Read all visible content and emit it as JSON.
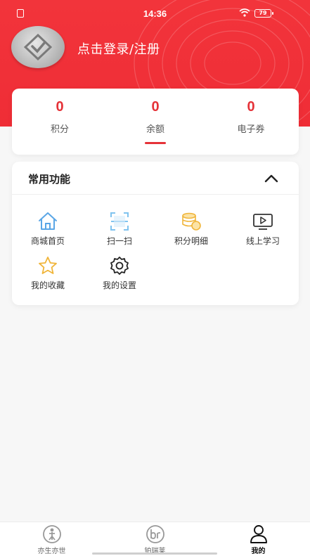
{
  "status_bar": {
    "time": "14:36",
    "battery": "79"
  },
  "profile": {
    "login_text": "点击登录/注册"
  },
  "stats": [
    {
      "value": "0",
      "label": "积分"
    },
    {
      "value": "0",
      "label": "余额"
    },
    {
      "value": "0",
      "label": "电子券"
    }
  ],
  "functions": {
    "title": "常用功能",
    "items": [
      {
        "label": "商城首页",
        "icon": "home-icon"
      },
      {
        "label": "扫一扫",
        "icon": "scan-icon"
      },
      {
        "label": "积分明细",
        "icon": "coins-icon"
      },
      {
        "label": "线上学习",
        "icon": "video-icon"
      },
      {
        "label": "我的收藏",
        "icon": "star-icon"
      },
      {
        "label": "我的设置",
        "icon": "gear-icon"
      }
    ]
  },
  "bottom_nav": {
    "items": [
      {
        "label": "亦生亦世",
        "icon": "yisheng-logo-icon"
      },
      {
        "label": "铂瑞莱",
        "icon": "br-logo-icon"
      },
      {
        "label": "我的",
        "icon": "user-icon"
      }
    ],
    "active_index": 2
  },
  "colors": {
    "brand_red": "#ef2d36",
    "accent_red": "#e53238",
    "icon_blue": "#5aa6e6",
    "icon_gold": "#f0b53a"
  }
}
